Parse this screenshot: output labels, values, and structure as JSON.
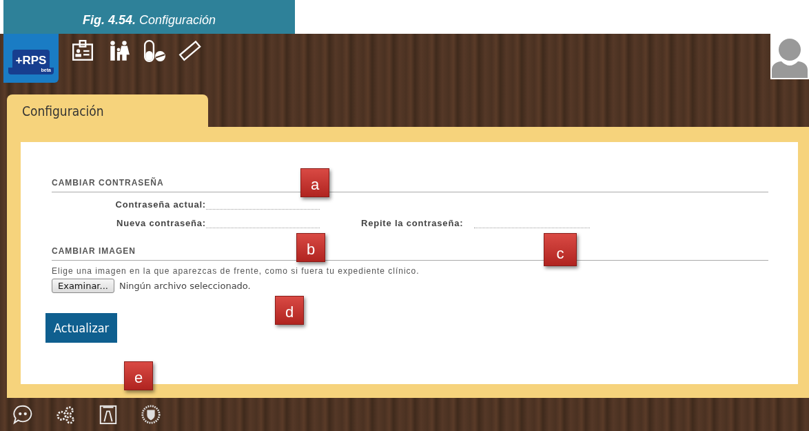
{
  "caption": {
    "label": "Fig. 4.54.",
    "title": "Configuración"
  },
  "logo": {
    "text": "+RPS",
    "badge": "beta"
  },
  "tab": {
    "label": "Configuración",
    "selected": true
  },
  "password_section": {
    "heading": "CAMBIAR CONTRASEÑA",
    "fields": [
      {
        "label": "Contraseña actual:"
      },
      {
        "label": "Nueva contraseña:"
      },
      {
        "label": "Repite la contraseña:"
      }
    ]
  },
  "image_section": {
    "heading": "CAMBIAR IMAGEN",
    "hint": "Elige una imagen en la que aparezcas de frente, como si fuera tu expediente clínico.",
    "browse_button": "Examinar...",
    "file_status": "Ningún archivo seleccionado."
  },
  "submit_button": "Actualizar",
  "markers": [
    "a",
    "b",
    "c",
    "d",
    "e"
  ]
}
